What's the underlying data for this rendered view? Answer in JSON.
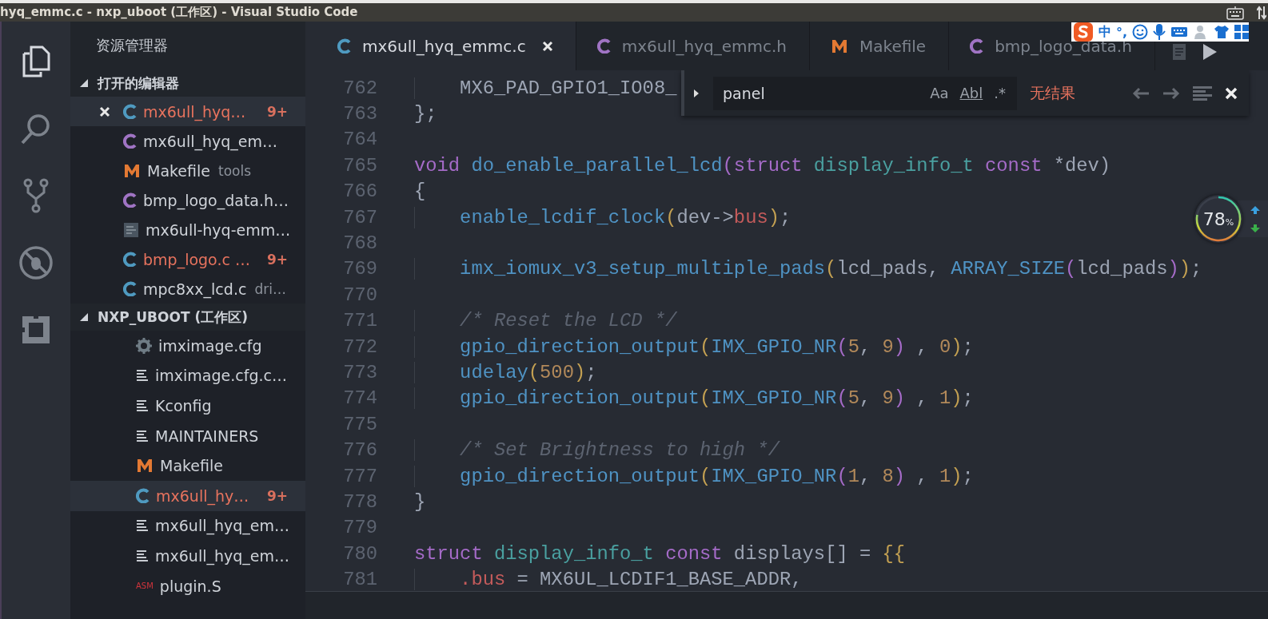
{
  "window": {
    "title": "hyq_emmc.c - nxp_uboot (工作区) - Visual Studio Code"
  },
  "activity_bar": [
    {
      "kind": "files",
      "selected": true
    },
    {
      "kind": "search",
      "selected": false
    },
    {
      "kind": "git",
      "selected": false
    },
    {
      "kind": "debug",
      "selected": false
    },
    {
      "kind": "extensions",
      "selected": false
    }
  ],
  "sidebar": {
    "title": "资源管理器",
    "open_editors": {
      "title": "打开的编辑器",
      "expanded": true,
      "items": [
        {
          "kind": "c",
          "name": "mx6ull_hyq…",
          "badge": "9+",
          "modified": true,
          "selected": true
        },
        {
          "kind": "h",
          "name": "mx6ull_hyq_em…",
          "modified": false,
          "selected": false
        },
        {
          "kind": "m",
          "name": "Makefile",
          "detail": "tools",
          "modified": false,
          "selected": false
        },
        {
          "kind": "h",
          "name": "bmp_logo_data.h…",
          "modified": false,
          "selected": false
        },
        {
          "kind": "doc",
          "name": "mx6ull-hyq-emm…",
          "modified": false,
          "selected": false
        },
        {
          "kind": "c",
          "name": "bmp_logo.c …",
          "badge": "9+",
          "modified": true,
          "selected": false
        },
        {
          "kind": "c",
          "name": "mpc8xx_lcd.c",
          "detail": "dri…",
          "modified": false,
          "selected": false
        }
      ]
    },
    "workspace": {
      "title": "NXP_UBOOT (工作区)",
      "expanded": true,
      "children": [
        {
          "kind": "gear",
          "name": "imximage.cfg",
          "modified": false,
          "selected": false
        },
        {
          "kind": "lines",
          "name": "imximage.cfg.c…",
          "modified": false,
          "selected": false
        },
        {
          "kind": "lines",
          "name": "Kconfig",
          "modified": false,
          "selected": false
        },
        {
          "kind": "lines",
          "name": "MAINTAINERS",
          "modified": false,
          "selected": false
        },
        {
          "kind": "m",
          "name": "Makefile",
          "modified": false,
          "selected": false
        },
        {
          "kind": "c",
          "name": "mx6ull_hy…",
          "badge": "9+",
          "modified": true,
          "selected": true
        },
        {
          "kind": "lines",
          "name": "mx6ull_hyq_em…",
          "modified": false,
          "selected": false
        },
        {
          "kind": "lines",
          "name": "mx6ull_hyq_em…",
          "modified": false,
          "selected": false
        },
        {
          "kind": "asm",
          "icon_text": "ASM",
          "name": "plugin.S",
          "modified": false,
          "selected": false
        }
      ]
    }
  },
  "tabs": [
    {
      "kind": "c",
      "label": "mx6ull_hyq_emmc.c",
      "selected": true
    },
    {
      "kind": "h",
      "label": "mx6ull_hyq_emmc.h",
      "selected": false
    },
    {
      "kind": "m",
      "label": "Makefile",
      "selected": false
    },
    {
      "kind": "h",
      "label": "bmp_logo_data.h",
      "selected": false
    }
  ],
  "find_widget": {
    "value": "panel",
    "options": [
      "Aa",
      "Abl",
      ".*"
    ],
    "status": "无结果"
  },
  "editor": {
    "lines": [
      {
        "number": "762",
        "indented": true,
        "tokens": [
          {
            "kind": "plain",
            "text": "MX6_PAD_GPIO1_IO08_"
          }
        ]
      },
      {
        "number": "763",
        "indented": false,
        "tokens": [
          {
            "kind": "plain",
            "text": "};"
          }
        ]
      },
      {
        "number": "764"
      },
      {
        "number": "765",
        "indented": false,
        "tokens": [
          {
            "kind": "kw",
            "text": "void "
          },
          {
            "kind": "fn",
            "text": "do_enable_parallel_lcd"
          },
          {
            "kind": "paren2",
            "text": "("
          },
          {
            "kind": "kw",
            "text": "struct "
          },
          {
            "kind": "type",
            "text": "display_info_t "
          },
          {
            "kind": "kw",
            "text": "const"
          },
          {
            "kind": "plain",
            "text": " *dev)"
          }
        ]
      },
      {
        "number": "766",
        "indented": false,
        "tokens": [
          {
            "kind": "plain",
            "text": "{"
          }
        ]
      },
      {
        "number": "767",
        "indented": true,
        "tokens": [
          {
            "kind": "fn",
            "text": "enable_lcdif_clock"
          },
          {
            "kind": "paren",
            "text": "("
          },
          {
            "kind": "plain",
            "text": "dev->"
          },
          {
            "kind": "field",
            "text": "bus"
          },
          {
            "kind": "paren",
            "text": ")"
          },
          {
            "kind": "plain",
            "text": ";"
          }
        ]
      },
      {
        "number": "768"
      },
      {
        "number": "769",
        "indented": true,
        "tokens": [
          {
            "kind": "fn",
            "text": "imx_iomux_v3_setup_multiple_pads"
          },
          {
            "kind": "paren",
            "text": "("
          },
          {
            "kind": "plain",
            "text": "lcd_pads, "
          },
          {
            "kind": "fn",
            "text": "ARRAY_SIZE"
          },
          {
            "kind": "paren2",
            "text": "("
          },
          {
            "kind": "plain",
            "text": "lcd_pads"
          },
          {
            "kind": "paren2",
            "text": ")"
          },
          {
            "kind": "paren",
            "text": ")"
          },
          {
            "kind": "plain",
            "text": ";"
          }
        ]
      },
      {
        "number": "770"
      },
      {
        "number": "771",
        "indented": true,
        "tokens": [
          {
            "kind": "comment",
            "text": "/* Reset the LCD */"
          }
        ]
      },
      {
        "number": "772",
        "indented": true,
        "tokens": [
          {
            "kind": "fn",
            "text": "gpio_direction_output"
          },
          {
            "kind": "paren",
            "text": "("
          },
          {
            "kind": "fn",
            "text": "IMX_GPIO_NR"
          },
          {
            "kind": "paren2",
            "text": "("
          },
          {
            "kind": "num",
            "text": "5"
          },
          {
            "kind": "plain",
            "text": ", "
          },
          {
            "kind": "num",
            "text": "9"
          },
          {
            "kind": "paren2",
            "text": ")"
          },
          {
            "kind": "plain",
            "text": " , "
          },
          {
            "kind": "num",
            "text": "0"
          },
          {
            "kind": "paren",
            "text": ")"
          },
          {
            "kind": "plain",
            "text": ";"
          }
        ]
      },
      {
        "number": "773",
        "indented": true,
        "tokens": [
          {
            "kind": "fn",
            "text": "udelay"
          },
          {
            "kind": "paren",
            "text": "("
          },
          {
            "kind": "num",
            "text": "500"
          },
          {
            "kind": "paren",
            "text": ")"
          },
          {
            "kind": "plain",
            "text": ";"
          }
        ]
      },
      {
        "number": "774",
        "indented": true,
        "tokens": [
          {
            "kind": "fn",
            "text": "gpio_direction_output"
          },
          {
            "kind": "paren",
            "text": "("
          },
          {
            "kind": "fn",
            "text": "IMX_GPIO_NR"
          },
          {
            "kind": "paren2",
            "text": "("
          },
          {
            "kind": "num",
            "text": "5"
          },
          {
            "kind": "plain",
            "text": ", "
          },
          {
            "kind": "num",
            "text": "9"
          },
          {
            "kind": "paren2",
            "text": ")"
          },
          {
            "kind": "plain",
            "text": " , "
          },
          {
            "kind": "num",
            "text": "1"
          },
          {
            "kind": "paren",
            "text": ")"
          },
          {
            "kind": "plain",
            "text": ";"
          }
        ]
      },
      {
        "number": "775"
      },
      {
        "number": "776",
        "indented": true,
        "tokens": [
          {
            "kind": "comment",
            "text": "/* Set Brightness to high */"
          }
        ]
      },
      {
        "number": "777",
        "indented": true,
        "tokens": [
          {
            "kind": "fn",
            "text": "gpio_direction_output"
          },
          {
            "kind": "paren",
            "text": "("
          },
          {
            "kind": "fn",
            "text": "IMX_GPIO_NR"
          },
          {
            "kind": "paren2",
            "text": "("
          },
          {
            "kind": "num",
            "text": "1"
          },
          {
            "kind": "plain",
            "text": ", "
          },
          {
            "kind": "num",
            "text": "8"
          },
          {
            "kind": "paren2",
            "text": ")"
          },
          {
            "kind": "plain",
            "text": " , "
          },
          {
            "kind": "num",
            "text": "1"
          },
          {
            "kind": "paren",
            "text": ")"
          },
          {
            "kind": "plain",
            "text": ";"
          }
        ]
      },
      {
        "number": "778",
        "indented": false,
        "tokens": [
          {
            "kind": "plain",
            "text": "}"
          }
        ]
      },
      {
        "number": "779"
      },
      {
        "number": "780",
        "indented": false,
        "tokens": [
          {
            "kind": "kw",
            "text": "struct "
          },
          {
            "kind": "type",
            "text": "display_info_t "
          },
          {
            "kind": "kw",
            "text": "const"
          },
          {
            "kind": "plain",
            "text": " displays[] = "
          },
          {
            "kind": "paren",
            "text": "{{"
          }
        ]
      },
      {
        "number": "781",
        "indented": true,
        "tokens": [
          {
            "kind": "field",
            "text": ".bus"
          },
          {
            "kind": "plain",
            "text": " = MX6UL_LCDIF1_BASE_ADDR,"
          }
        ]
      }
    ]
  },
  "ime_toolbar": {
    "mode": "中",
    "punctuation": "°,"
  },
  "gauge": {
    "value": "78",
    "unit": "%"
  }
}
